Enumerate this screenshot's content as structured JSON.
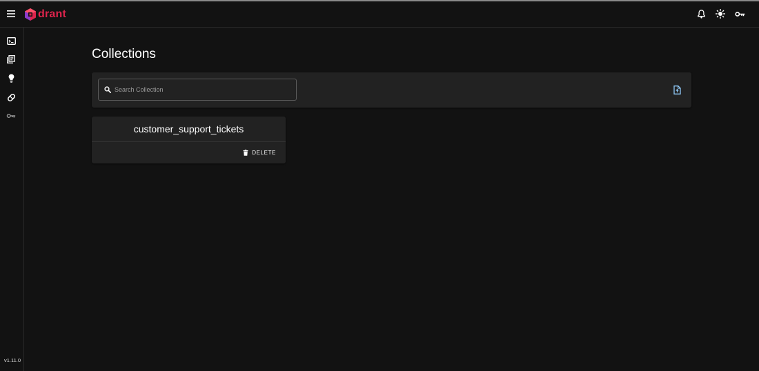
{
  "app": {
    "logo_text": "drant",
    "brand_color": "#dc244c",
    "version": "v1.11.0"
  },
  "header": {
    "icons": [
      "menu-icon",
      "bell-icon",
      "sun-icon",
      "key-icon"
    ]
  },
  "sidebar": {
    "items": [
      {
        "icon": "console-icon"
      },
      {
        "icon": "collections-icon"
      },
      {
        "icon": "lightbulb-icon"
      },
      {
        "icon": "datasets-icon"
      },
      {
        "icon": "key-icon"
      }
    ]
  },
  "main": {
    "title": "Collections",
    "search": {
      "placeholder": "Search Collection",
      "value": ""
    },
    "toolbar": {
      "upload_icon": "upload-file-icon"
    },
    "collections": [
      {
        "name": "customer_support_tickets",
        "delete_label": "DELETE"
      }
    ]
  }
}
